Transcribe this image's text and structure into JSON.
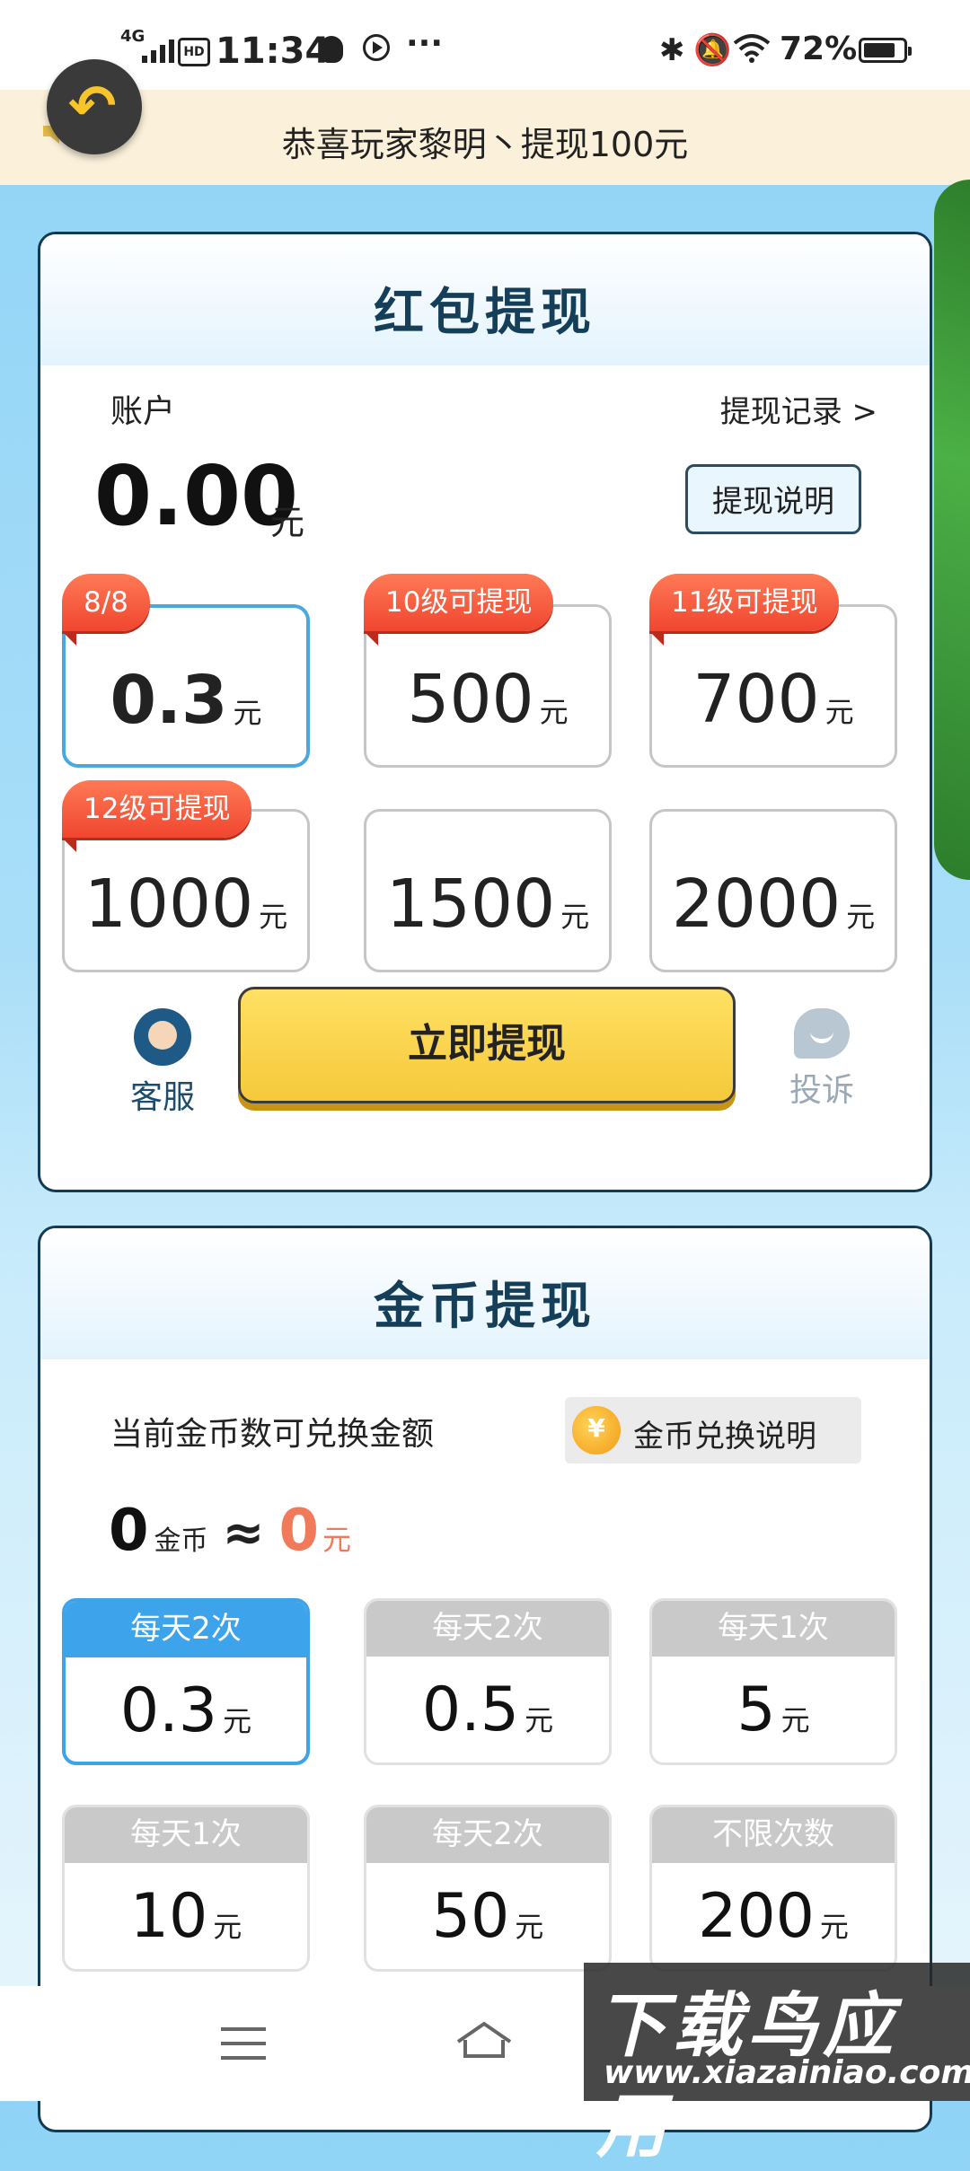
{
  "status_bar": {
    "network": "4G",
    "hd": "HD",
    "time": "11:34",
    "more": "···",
    "battery": "72%"
  },
  "notice": {
    "text": "恭喜玩家黎明丶提现100元"
  },
  "red_packet": {
    "title": "红包提现",
    "account_label": "账户",
    "record_link": "提现记录 >",
    "balance": "0.00",
    "balance_unit": "元",
    "explain_button": "提现说明",
    "options": [
      {
        "badge": "8/8",
        "amount": "0.3",
        "unit": "元",
        "selected": true
      },
      {
        "badge": "10级可提现",
        "amount": "500",
        "unit": "元",
        "selected": false
      },
      {
        "badge": "11级可提现",
        "amount": "700",
        "unit": "元",
        "selected": false
      },
      {
        "badge": "12级可提现",
        "amount": "1000",
        "unit": "元",
        "selected": false
      },
      {
        "badge": "",
        "amount": "1500",
        "unit": "元",
        "selected": false
      },
      {
        "badge": "",
        "amount": "2000",
        "unit": "元",
        "selected": false
      }
    ],
    "service_label": "客服",
    "withdraw_button": "立即提现",
    "complain_label": "投诉"
  },
  "coins": {
    "title": "金币提现",
    "exchange_label": "当前金币数可兑换金额",
    "explain_button": "金币兑换说明",
    "coin_count": "0",
    "coin_unit": "金币",
    "approx": "≈",
    "money": "0",
    "money_unit": "元",
    "options": [
      {
        "limit": "每天2次",
        "amount": "0.3",
        "unit": "元",
        "selected": true
      },
      {
        "limit": "每天2次",
        "amount": "0.5",
        "unit": "元",
        "selected": false
      },
      {
        "limit": "每天1次",
        "amount": "5",
        "unit": "元",
        "selected": false
      },
      {
        "limit": "每天1次",
        "amount": "10",
        "unit": "元",
        "selected": false
      },
      {
        "limit": "每天2次",
        "amount": "50",
        "unit": "元",
        "selected": false
      },
      {
        "limit": "不限次数",
        "amount": "200",
        "unit": "元",
        "selected": false
      }
    ]
  },
  "watermark": {
    "big": "下载鸟应用",
    "small": "www.xiazainiao.com"
  },
  "colors": {
    "accent_blue": "#3da3eb",
    "ribbon_red": "#f0462f",
    "button_yellow": "#f5c93a",
    "money_red": "#f07a5a"
  }
}
